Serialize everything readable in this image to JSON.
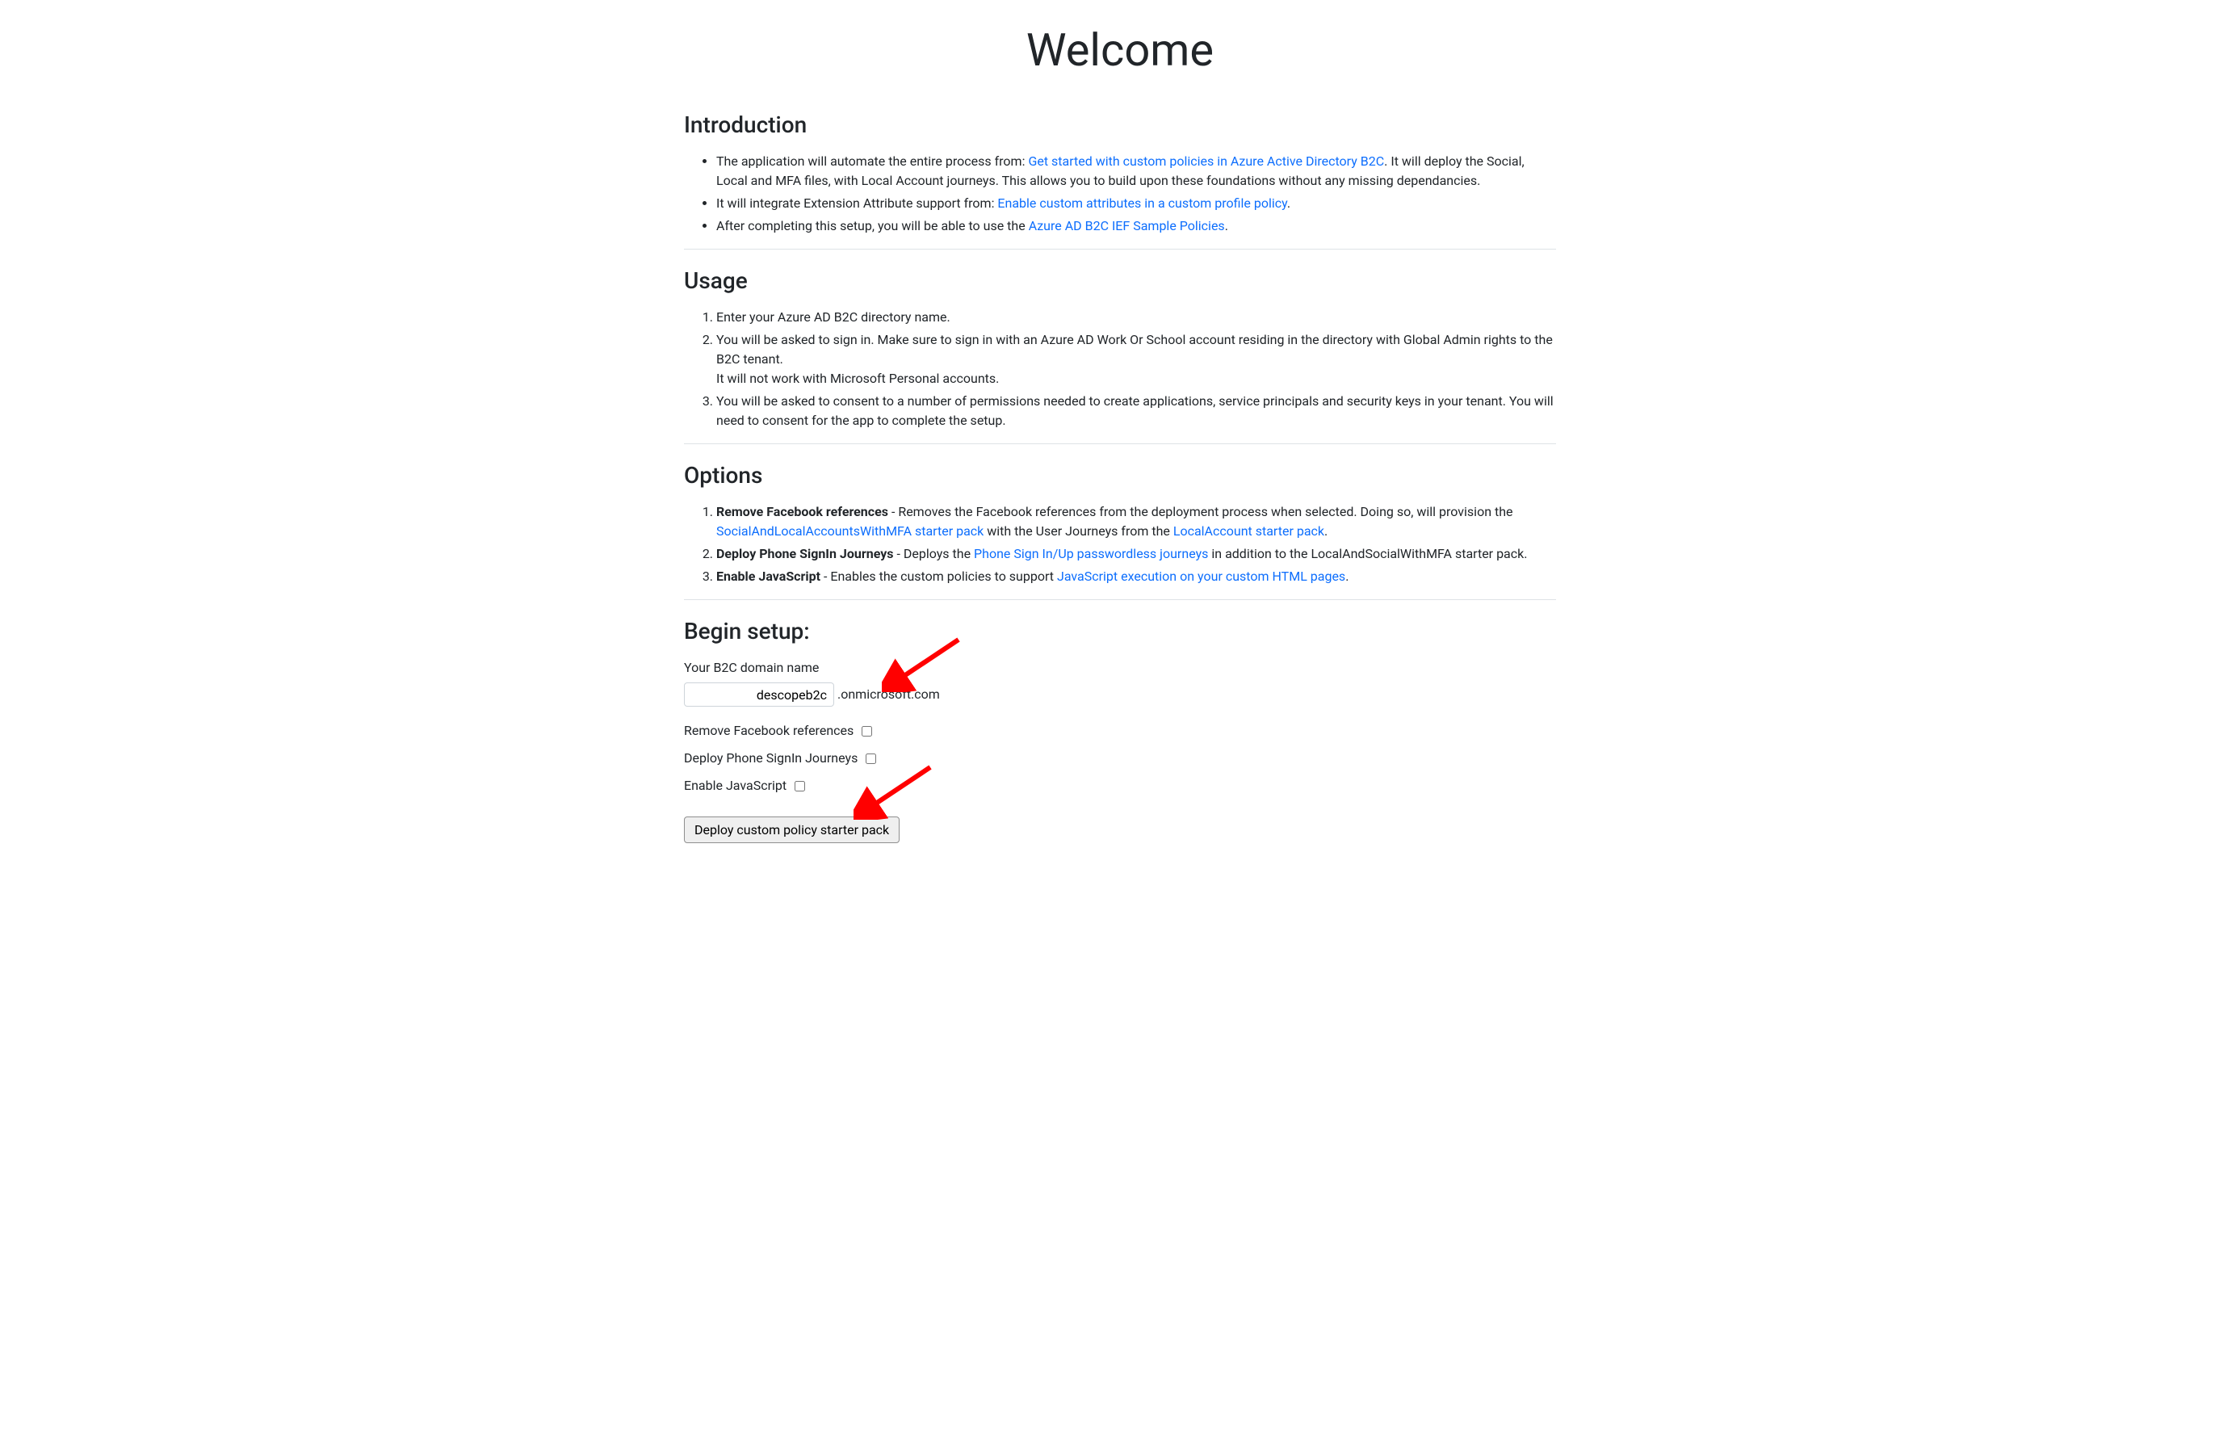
{
  "title": "Welcome",
  "sections": {
    "introduction": {
      "heading": "Introduction",
      "items": [
        {
          "pre": "The application will automate the entire process from: ",
          "link": "Get started with custom policies in Azure Active Directory B2C",
          "post": ". It will deploy the Social, Local and MFA files, with Local Account journeys. This allows you to build upon these foundations without any missing dependancies."
        },
        {
          "pre": "It will integrate Extension Attribute support from: ",
          "link": "Enable custom attributes in a custom profile policy",
          "post": "."
        },
        {
          "pre": "After completing this setup, you will be able to use the ",
          "link": "Azure AD B2C IEF Sample Policies",
          "post": "."
        }
      ]
    },
    "usage": {
      "heading": "Usage",
      "items": [
        "Enter your Azure AD B2C directory name.",
        "You will be asked to sign in. Make sure to sign in with an Azure AD Work Or School account residing in the directory with Global Admin rights to the B2C tenant.\nIt will not work with Microsoft Personal accounts.",
        "You will be asked to consent to a number of permissions needed to create applications, service principals and security keys in your tenant. You will need to consent for the app to complete the setup."
      ]
    },
    "options": {
      "heading": "Options",
      "items": {
        "remove_fb": {
          "bold": "Remove Facebook references",
          "text1": " - Removes the Facebook references from the deployment process when selected. Doing so, will provision the ",
          "link1": "SocialAndLocalAccountsWithMFA starter pack",
          "text2": " with the User Journeys from the ",
          "link2": "LocalAccount starter pack",
          "text3": "."
        },
        "deploy_phone": {
          "bold": "Deploy Phone SignIn Journeys",
          "text1": " - Deploys the ",
          "link1": "Phone Sign In/Up passwordless journeys",
          "text2": " in addition to the LocalAndSocialWithMFA starter pack."
        },
        "enable_js": {
          "bold": "Enable JavaScript",
          "text1": " - Enables the custom policies to support ",
          "link1": "JavaScript execution on your custom HTML pages",
          "text2": "."
        }
      }
    },
    "begin_setup": {
      "heading": "Begin setup:",
      "domain_label": "Your B2C domain name",
      "domain_value": "descopeb2c",
      "domain_suffix": ".onmicrosoft.com",
      "cb_remove_fb": "Remove Facebook references",
      "cb_deploy_phone": "Deploy Phone SignIn Journeys",
      "cb_enable_js": "Enable JavaScript",
      "deploy_button": "Deploy custom policy starter pack"
    }
  }
}
